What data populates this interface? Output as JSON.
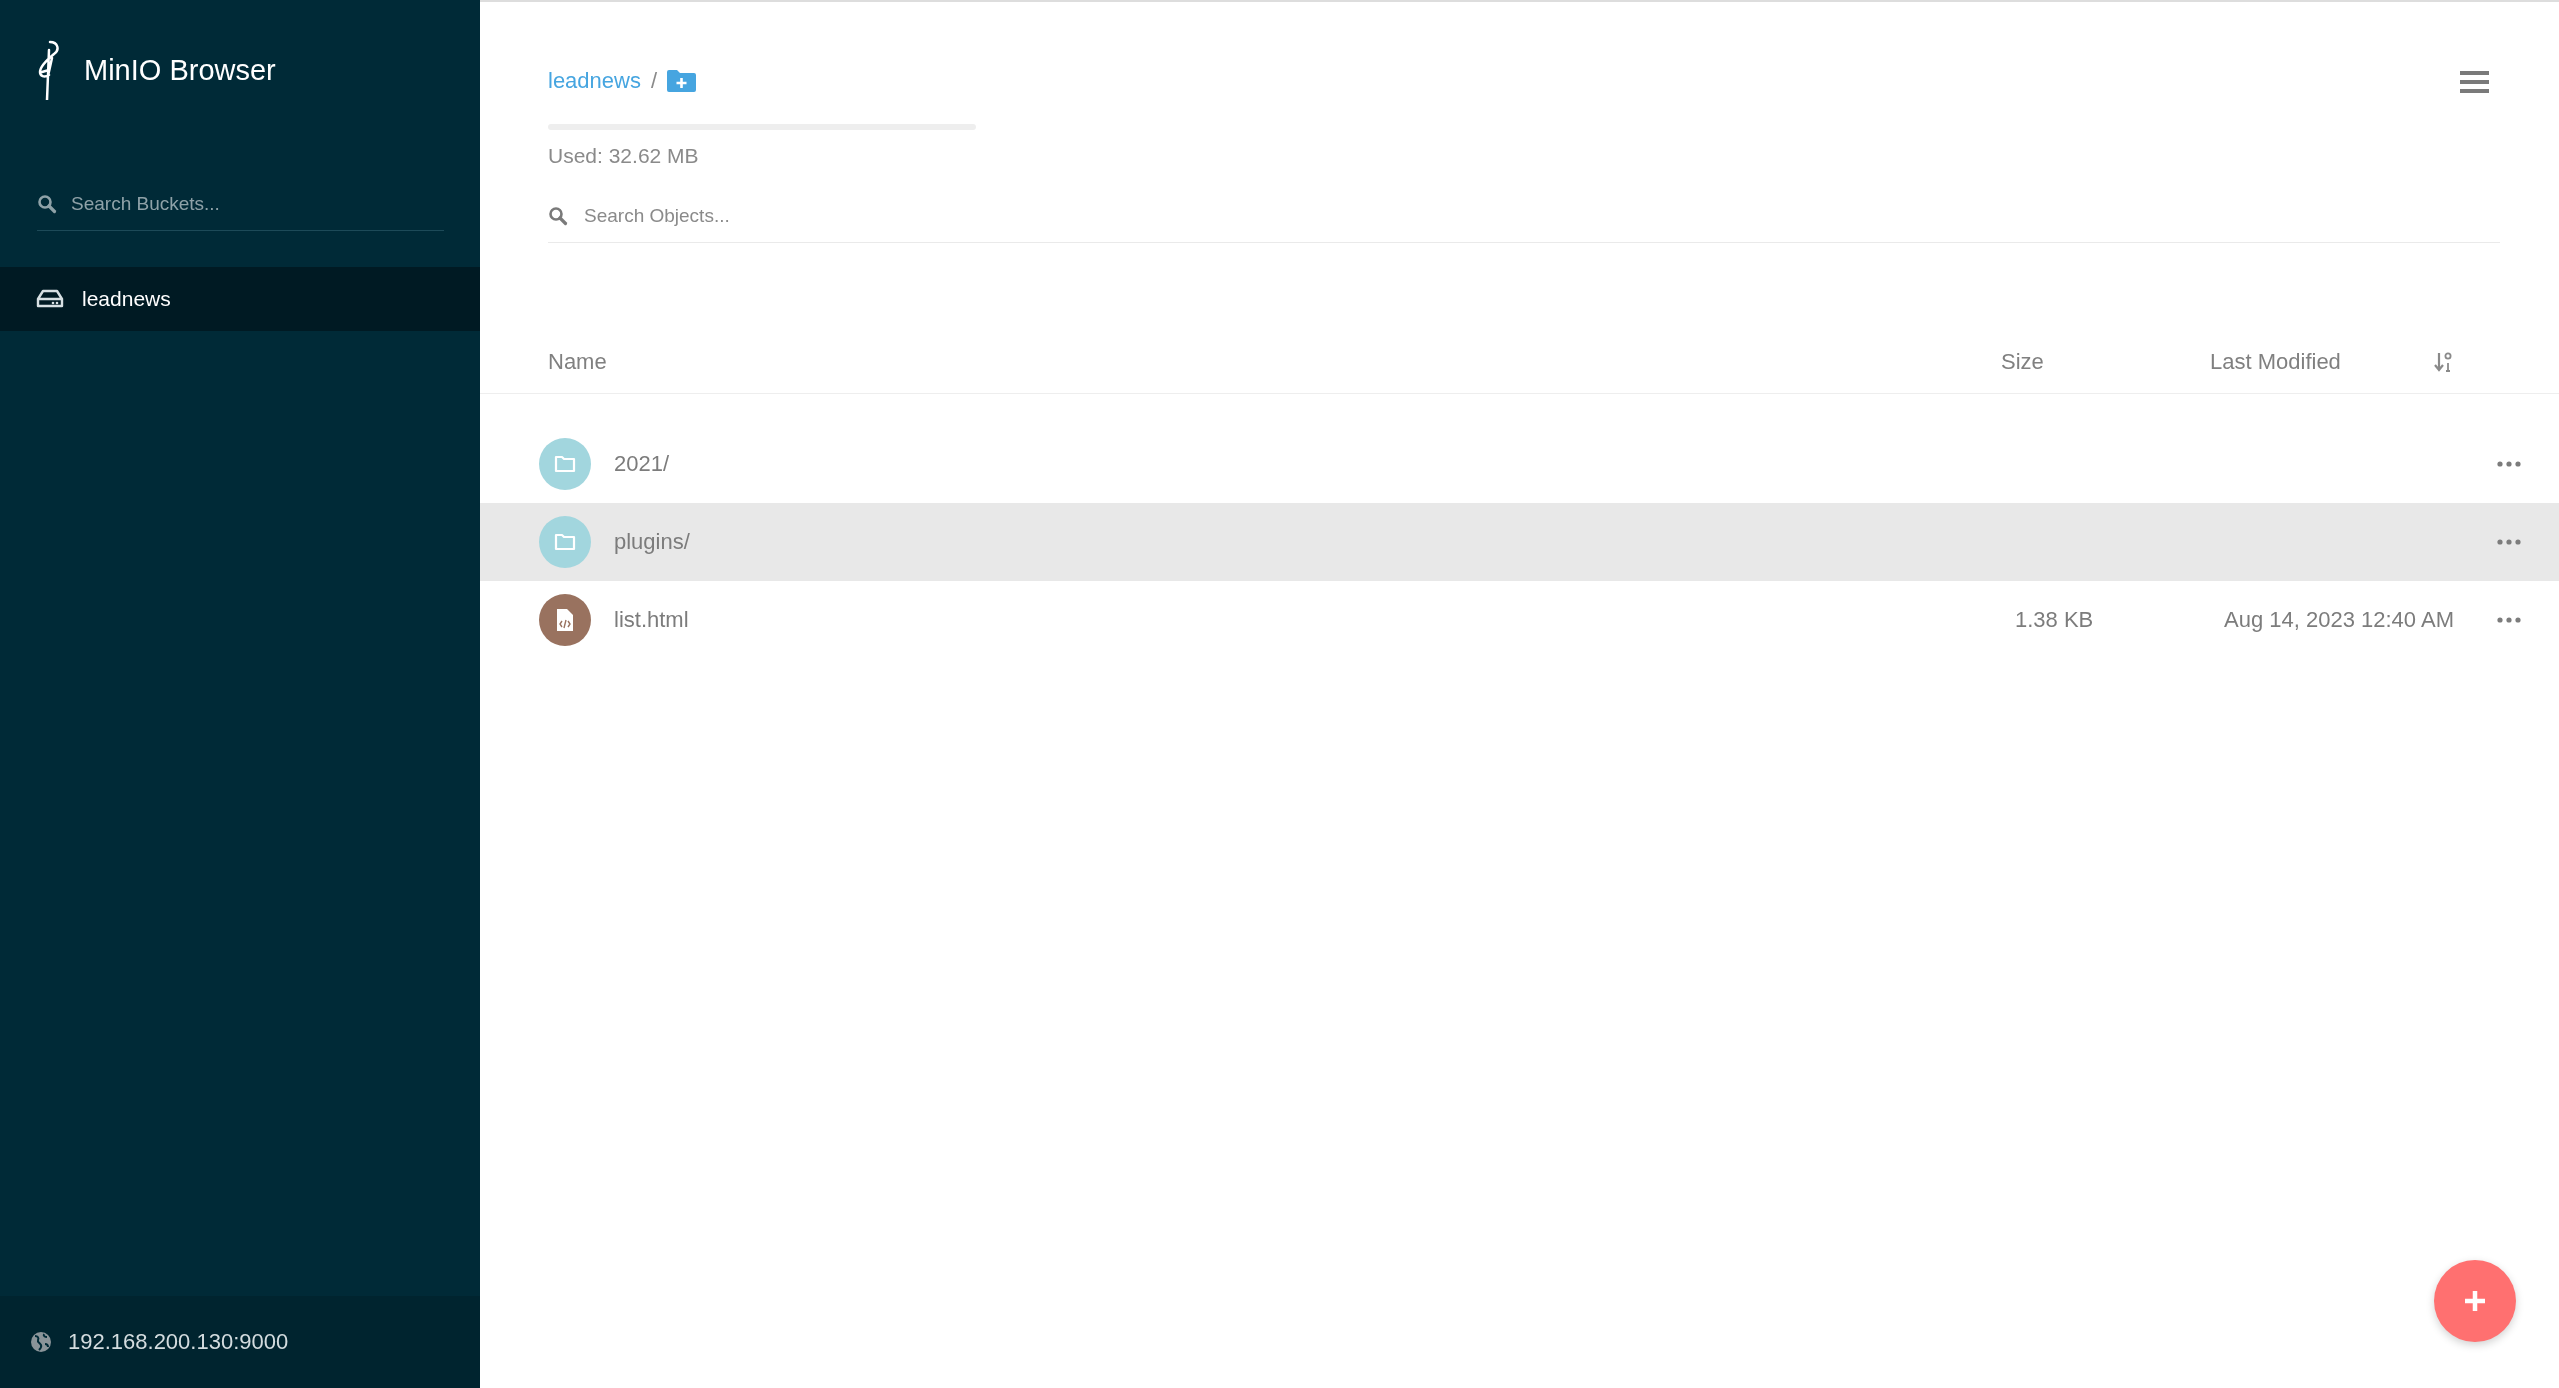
{
  "sidebar": {
    "logo_text": "MinIO Browser",
    "search": {
      "placeholder": "Search Buckets..."
    },
    "buckets": [
      {
        "name": "leadnews",
        "selected": true
      }
    ],
    "host": "192.168.200.130:9000"
  },
  "main": {
    "breadcrumb": {
      "bucket": "leadnews",
      "separator": "/"
    },
    "storage": {
      "used": "Used: 32.62 MB"
    },
    "search": {
      "placeholder": "Search Objects..."
    },
    "columns": [
      "Name",
      "Size",
      "Last Modified"
    ],
    "rows": [
      {
        "kind": "folder",
        "name": "2021/",
        "highlighted": false
      },
      {
        "kind": "folder",
        "name": "plugins/",
        "highlighted": true
      },
      {
        "kind": "file",
        "name": "list.html",
        "size": "1.38 KB",
        "modified": "Aug 14, 2023 12:40 AM",
        "highlighted": false
      }
    ]
  }
}
